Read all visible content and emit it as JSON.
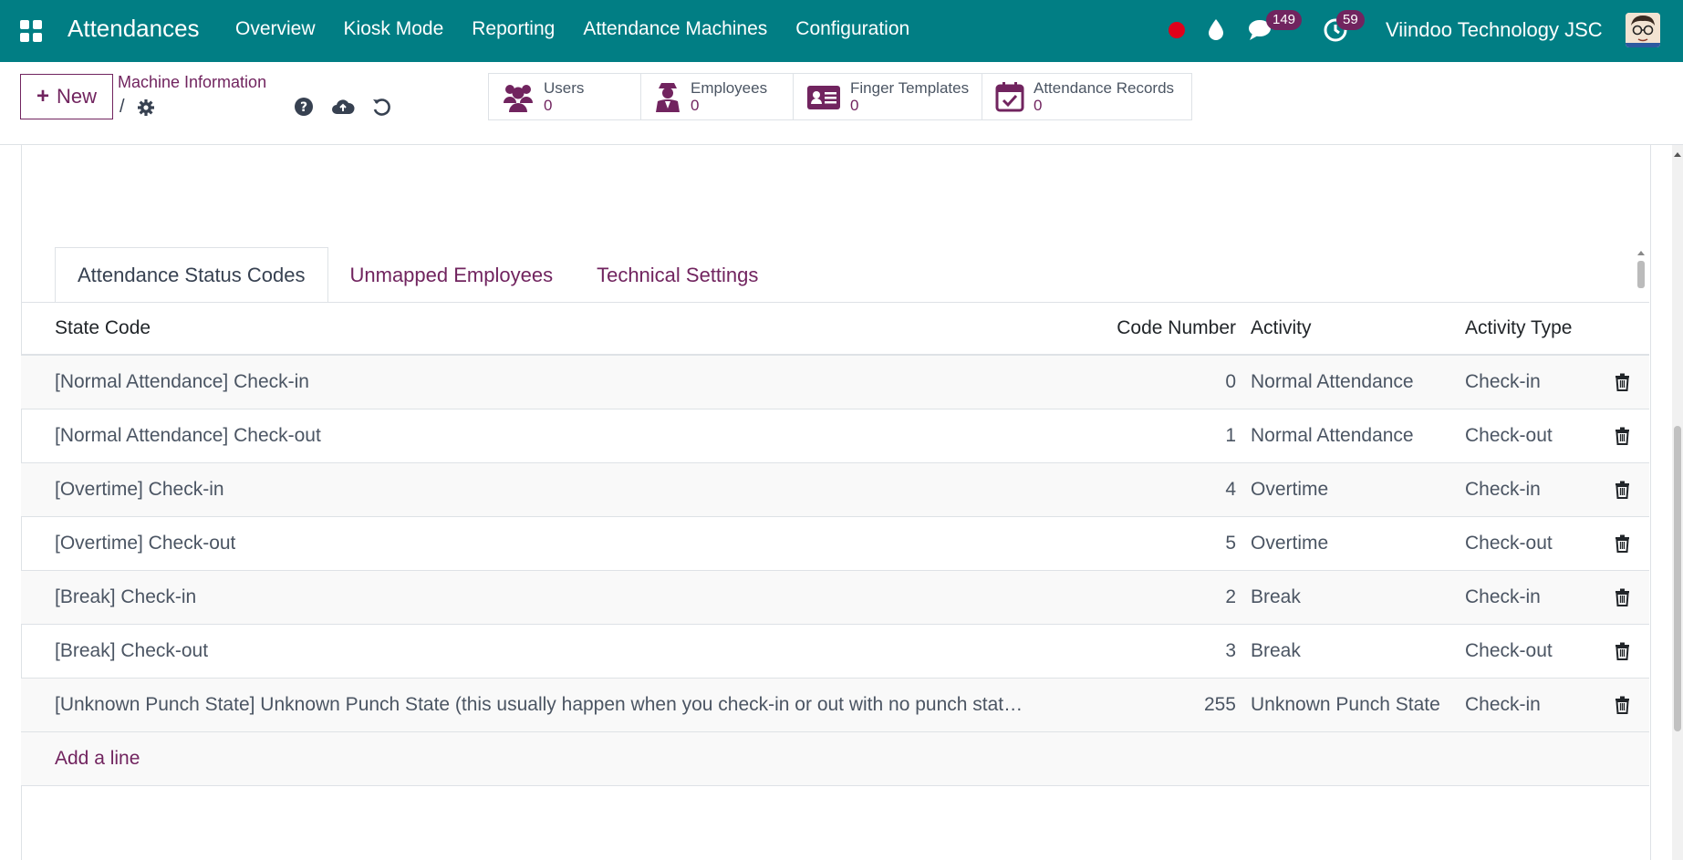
{
  "navbar": {
    "app_title": "Attendances",
    "menu": [
      "Overview",
      "Kiosk Mode",
      "Reporting",
      "Attendance Machines",
      "Configuration"
    ],
    "messages_count": "149",
    "activities_count": "59",
    "company": "Viindoo Technology JSC",
    "colors": {
      "bar": "#017e84",
      "badge": "#71245f",
      "record": "#e0001a"
    }
  },
  "control": {
    "new_label": "New",
    "breadcrumb": "Machine Information",
    "breadcrumb_sep": "/",
    "stats": [
      {
        "icon": "users-icon",
        "label": "Users",
        "value": "0"
      },
      {
        "icon": "employee-icon",
        "label": "Employees",
        "value": "0"
      },
      {
        "icon": "id-card-icon",
        "label": "Finger Templates",
        "value": "0"
      },
      {
        "icon": "calendar-check-icon",
        "label": "Attendance Records",
        "value": "0"
      }
    ]
  },
  "tabs": [
    "Attendance Status Codes",
    "Unmapped Employees",
    "Technical Settings"
  ],
  "table": {
    "headers": {
      "state": "State Code",
      "code": "Code Number",
      "activity": "Activity",
      "type": "Activity Type"
    },
    "rows": [
      {
        "state": "[Normal Attendance] Check-in",
        "code": "0",
        "activity": "Normal Attendance",
        "type": "Check-in"
      },
      {
        "state": "[Normal Attendance] Check-out",
        "code": "1",
        "activity": "Normal Attendance",
        "type": "Check-out"
      },
      {
        "state": "[Overtime] Check-in",
        "code": "4",
        "activity": "Overtime",
        "type": "Check-in"
      },
      {
        "state": "[Overtime] Check-out",
        "code": "5",
        "activity": "Overtime",
        "type": "Check-out"
      },
      {
        "state": "[Break] Check-in",
        "code": "2",
        "activity": "Break",
        "type": "Check-in"
      },
      {
        "state": "[Break] Check-out",
        "code": "3",
        "activity": "Break",
        "type": "Check-out"
      },
      {
        "state": "[Unknown Punch State] Unknown Punch State (this usually happen when you check-in or out with no punch stat…",
        "code": "255",
        "activity": "Unknown Punch State",
        "type": "Check-in"
      }
    ],
    "add_line": "Add a line"
  }
}
